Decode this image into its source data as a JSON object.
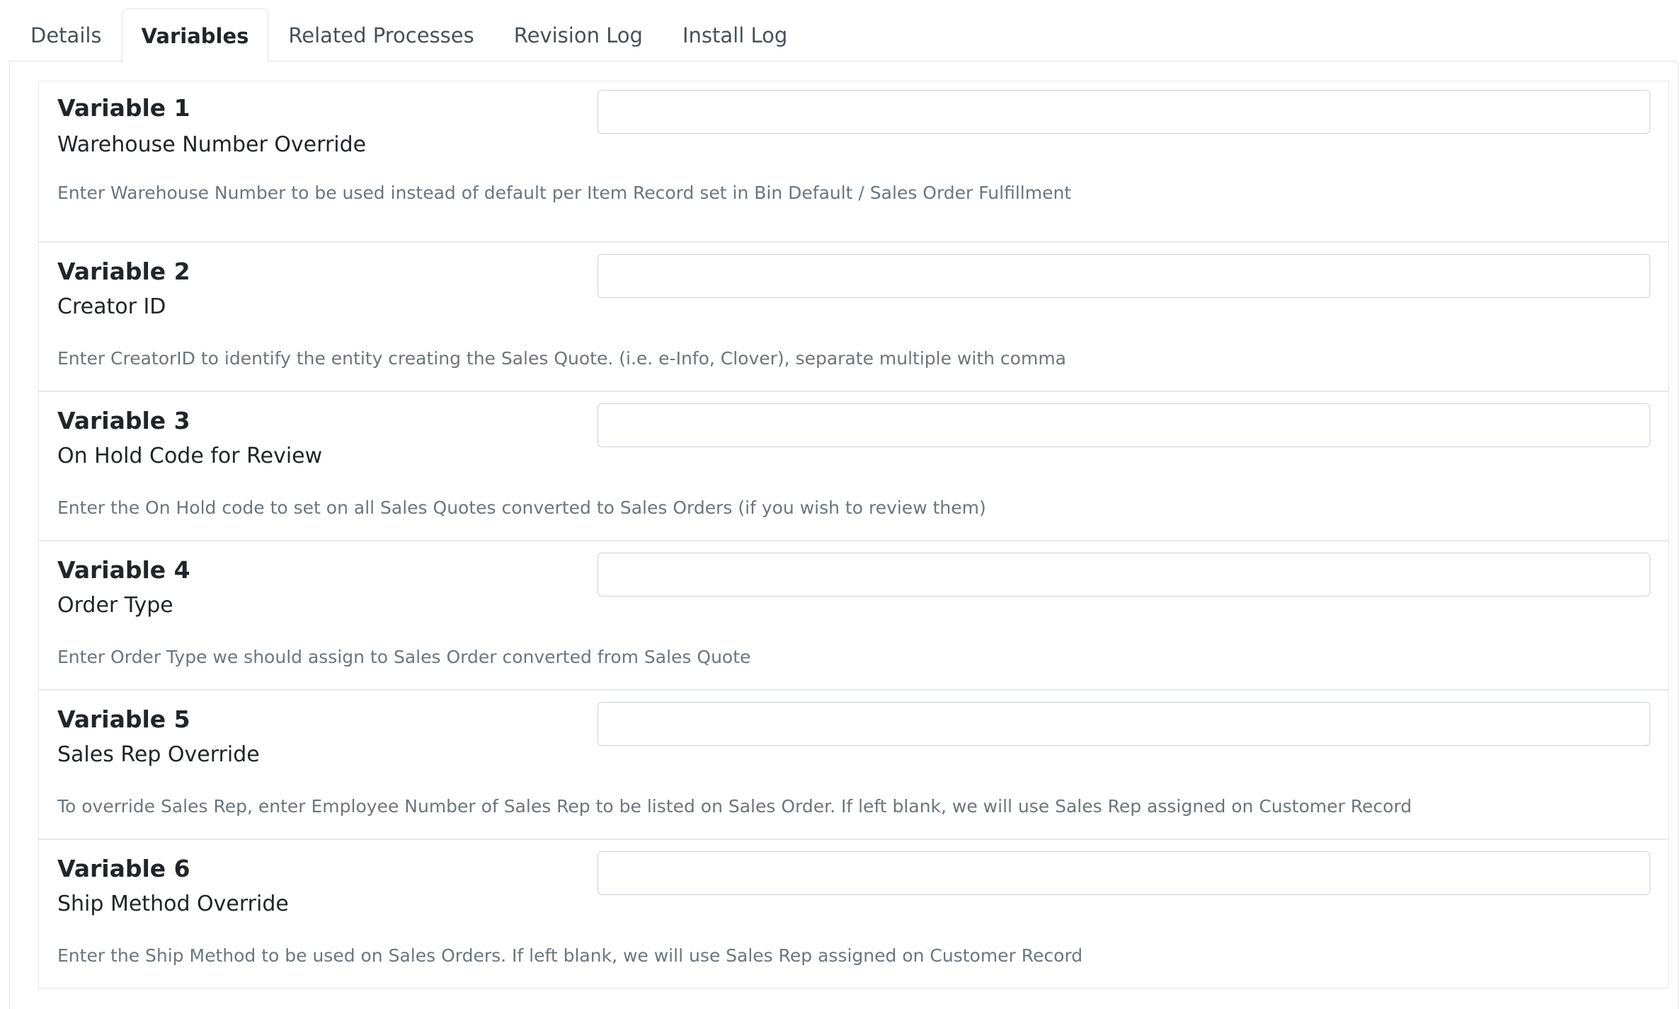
{
  "tabs": [
    {
      "label": "Details",
      "active": false
    },
    {
      "label": "Variables",
      "active": true
    },
    {
      "label": "Related Processes",
      "active": false
    },
    {
      "label": "Revision Log",
      "active": false
    },
    {
      "label": "Install Log",
      "active": false
    }
  ],
  "variables": [
    {
      "title": "Variable 1",
      "label": "Warehouse Number Override",
      "description": "Enter Warehouse Number to be used instead of default per Item Record set in Bin Default / Sales Order Fulfillment",
      "value": ""
    },
    {
      "title": "Variable 2",
      "label": "Creator ID",
      "description": "Enter CreatorID to identify the entity creating the Sales Quote. (i.e. e-Info, Clover), separate multiple with comma",
      "value": ""
    },
    {
      "title": "Variable 3",
      "label": "On Hold Code for Review",
      "description": "Enter the On Hold code to set on all Sales Quotes converted to Sales Orders (if you wish to review them)",
      "value": ""
    },
    {
      "title": "Variable 4",
      "label": "Order Type",
      "description": "Enter Order Type we should assign to Sales Order converted from Sales Quote",
      "value": ""
    },
    {
      "title": "Variable 5",
      "label": "Sales Rep Override",
      "description": "To override Sales Rep, enter Employee Number of Sales Rep to be listed on Sales Order. If left blank, we will use Sales Rep assigned on Customer Record",
      "value": ""
    },
    {
      "title": "Variable 6",
      "label": "Ship Method Override",
      "description": "Enter the Ship Method to be used on Sales Orders. If left blank, we will use Sales Rep assigned on Customer Record",
      "value": ""
    }
  ]
}
